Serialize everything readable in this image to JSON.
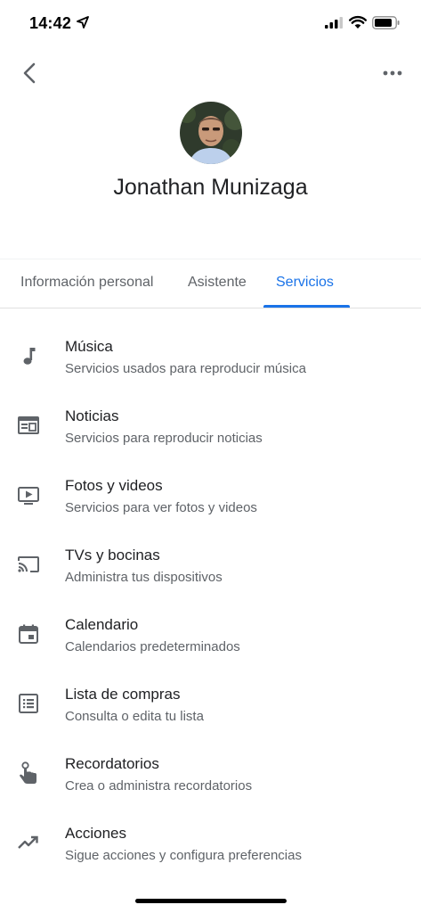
{
  "status_bar": {
    "time": "14:42"
  },
  "profile": {
    "name": "Jonathan Munizaga"
  },
  "tabs": [
    {
      "label": "Información personal",
      "active": false
    },
    {
      "label": "Asistente",
      "active": false
    },
    {
      "label": "Servicios",
      "active": true
    }
  ],
  "services": [
    {
      "title": "Música",
      "subtitle": "Servicios usados para reproducir música",
      "icon": "music-note-icon"
    },
    {
      "title": "Noticias",
      "subtitle": "Servicios para reproducir noticias",
      "icon": "newspaper-icon"
    },
    {
      "title": "Fotos y videos",
      "subtitle": "Servicios para ver fotos y videos",
      "icon": "video-screen-icon"
    },
    {
      "title": "TVs y bocinas",
      "subtitle": "Administra tus dispositivos",
      "icon": "cast-icon"
    },
    {
      "title": "Calendario",
      "subtitle": "Calendarios predeterminados",
      "icon": "calendar-icon"
    },
    {
      "title": "Lista de compras",
      "subtitle": "Consulta o edita tu lista",
      "icon": "list-icon"
    },
    {
      "title": "Recordatorios",
      "subtitle": "Crea o administra recordatorios",
      "icon": "reminder-hand-icon"
    },
    {
      "title": "Acciones",
      "subtitle": "Sigue acciones y configura preferencias",
      "icon": "trending-up-icon"
    }
  ],
  "colors": {
    "accent": "#1a73e8",
    "primary_text": "#202124",
    "secondary_text": "#5f6368",
    "icon": "#5f6368"
  }
}
